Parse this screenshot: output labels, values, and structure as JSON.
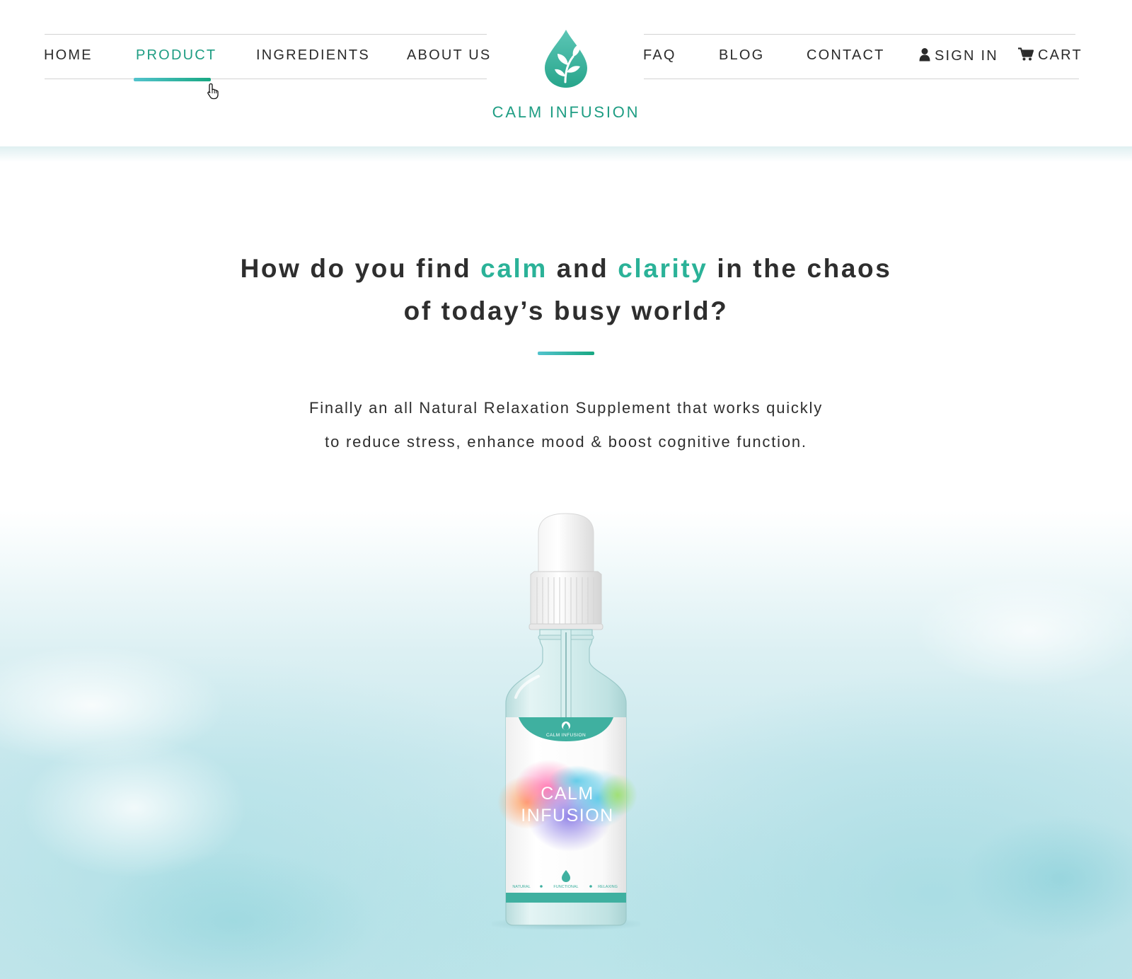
{
  "nav": {
    "left": [
      {
        "label": "HOME"
      },
      {
        "label": "PRODUCT",
        "active": true
      },
      {
        "label": "INGREDIENTS"
      },
      {
        "label": "ABOUT US"
      }
    ],
    "right": [
      {
        "label": "FAQ"
      },
      {
        "label": "BLOG"
      },
      {
        "label": "CONTACT"
      }
    ],
    "sign_in": {
      "label": "SIGN IN",
      "icon": "user-icon"
    },
    "cart": {
      "label": "CART",
      "icon": "cart-icon"
    }
  },
  "brand": {
    "name": "CALM INFUSION",
    "logo_icon": "leaf-drop-icon",
    "color": "#1e9d83"
  },
  "hero": {
    "headline": {
      "part1": "How do you find ",
      "highlight1": "calm",
      "part2": " and ",
      "highlight2": "clarity",
      "part3": " in the chaos",
      "line2": "of today’s busy world?"
    },
    "subtext": {
      "line1": "Finally an all Natural Relaxation Supplement that works quickly",
      "line2": "to reduce stress, enhance mood & boost cognitive function."
    }
  },
  "product": {
    "label_brand": "CALM INFUSION",
    "label_title_1": "CALM",
    "label_title_2": "INFUSION",
    "label_tags": [
      "NATURAL",
      "FUNCTIONAL",
      "RELAXING"
    ]
  },
  "colors": {
    "accent": "#2bb298",
    "accent_gradient_start": "#52c3cd",
    "accent_gradient_end": "#18a882",
    "text": "#2e2e2e"
  }
}
